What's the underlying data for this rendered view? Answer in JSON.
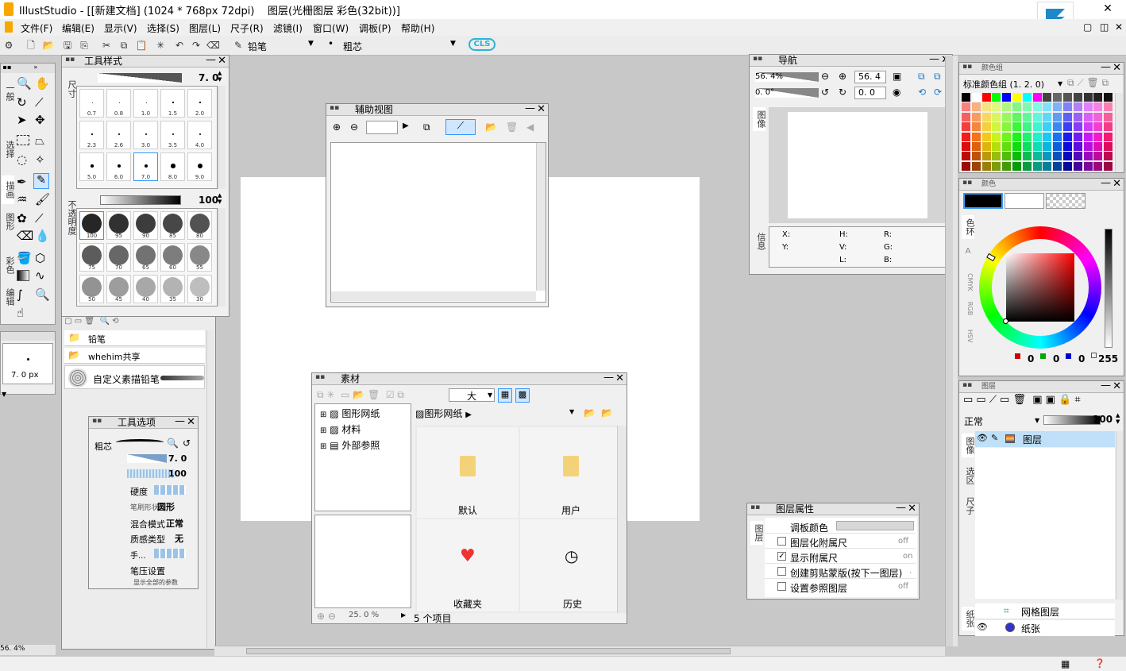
{
  "window": {
    "title": "IllustStudio - [[新建文档] (1024 * 768px 72dpi)    图层(光栅图层 彩色(32bit))]"
  },
  "menu": [
    "文件(F)",
    "编辑(E)",
    "显示(V)",
    "选择(S)",
    "图层(L)",
    "尺子(R)",
    "滤镜(I)",
    "窗口(W)",
    "调板(P)",
    "帮助(H)"
  ],
  "toolbar": {
    "tool_name": "铅笔",
    "brush_name": "粗芯",
    "logo": "CLS"
  },
  "tool_tabs": [
    "一般",
    "选择",
    "描画",
    "图形",
    "彩色",
    "编辑"
  ],
  "tool_style": {
    "title": "工具样式",
    "size_label": "尺寸",
    "size_value": "7. 0",
    "sizes": [
      "0.7",
      "0.8",
      "1.0",
      "1.5",
      "2.0",
      "2.3",
      "2.6",
      "3.0",
      "3.5",
      "4.0",
      "5.0",
      "6.0",
      "7.0",
      "8.0",
      "9.0"
    ],
    "opacity_label": "不透明度",
    "opacity_value": "100",
    "opacities": [
      "100",
      "95",
      "90",
      "85",
      "80",
      "75",
      "70",
      "65",
      "60",
      "55",
      "50",
      "45",
      "40",
      "35",
      "30"
    ]
  },
  "brush_preview": {
    "size": "7. 0 px",
    "zoom": "56. 4%"
  },
  "brush_list": [
    {
      "name": "铅笔"
    },
    {
      "name": "whehim共享"
    },
    {
      "name": "自定义素描铅笔"
    }
  ],
  "tool_options": {
    "title": "工具选项",
    "brush": "粗芯",
    "size": "7. 0",
    "density": "100",
    "hardness": "硬度",
    "shape_label": "笔刷形状",
    "shape": "圆形",
    "blend_label": "混合模式",
    "blend": "正常",
    "texture_label": "质感类型",
    "texture": "无",
    "hand": "手...",
    "pressure": "笔压设置",
    "show_all": "显示全部的参数"
  },
  "sub_view": {
    "title": "辅助视图"
  },
  "material": {
    "title": "素材",
    "size_option": "大",
    "tree": [
      "图形网纸",
      "材料",
      "外部参照"
    ],
    "path": "图形网纸",
    "items": [
      "默认",
      "用户",
      "收藏夹",
      "历史"
    ],
    "zoom": "25. 0 %",
    "count": "5 个项目"
  },
  "navigator": {
    "title": "导航",
    "zoom": "56. 4%",
    "zoom_value": "56. 4",
    "angle": "0. 0°",
    "angle_value": "0. 0",
    "tab_image": "图像",
    "tab_info": "信息",
    "info_labels": [
      "X:",
      "Y:",
      "H:",
      "V:",
      "L:",
      "R:",
      "G:",
      "B:"
    ]
  },
  "layer_props": {
    "title": "图层属性",
    "tab": "图层",
    "rows": [
      {
        "label": "调板颜色",
        "value": ""
      },
      {
        "label": "图层化附属尺",
        "value": "off"
      },
      {
        "label": "显示附属尺",
        "value": "on"
      },
      {
        "label": "创建剪贴蒙版(按下一图层)",
        "value": "."
      },
      {
        "label": "设置参照图层",
        "value": "off"
      }
    ]
  },
  "color_set": {
    "title": "颜色组",
    "name": "标准颜色组 (1. 2. 0)"
  },
  "color": {
    "title": "颜色",
    "tabs": [
      "色环",
      "A",
      "CMYK",
      "RGB",
      "HSV"
    ],
    "r": "0",
    "g": "0",
    "b": "0",
    "alpha": "255"
  },
  "layers": {
    "title": "图层",
    "blend": "正常",
    "opacity": "100",
    "tabs": [
      "图像",
      "选区",
      "尺子"
    ],
    "paper_tab": "纸张",
    "items": [
      "图层",
      "网格图层",
      "纸张"
    ]
  },
  "colors": {
    "accent": "#3399ff",
    "selected_row": "#bfe0f8"
  }
}
